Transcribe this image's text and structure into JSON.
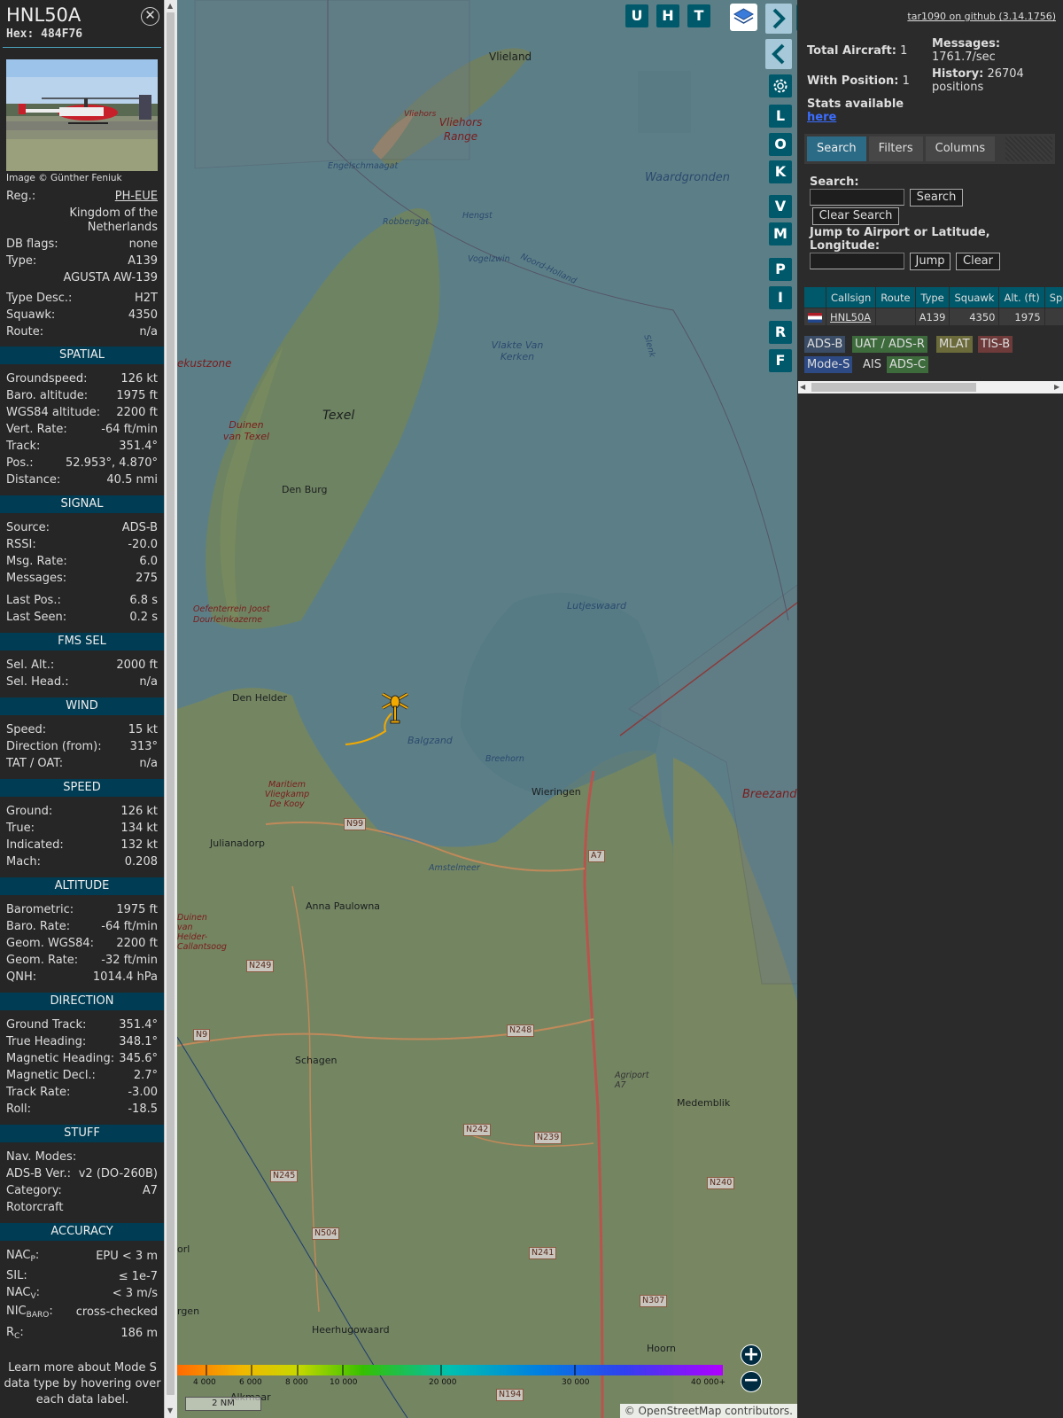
{
  "aircraft": {
    "callsign": "HNL50A",
    "hex_label": "Hex: 484F76",
    "photo_credit": "Image © Günther Feniuk"
  },
  "details": {
    "reg_label": "Reg.:",
    "reg": "PH-EUE",
    "country": "Kingdom of the Netherlands",
    "dbflags_label": "DB flags:",
    "dbflags": "none",
    "type_label": "Type:",
    "type": "A139",
    "type_name": "AGUSTA AW-139",
    "typedesc_label": "Type Desc.:",
    "typedesc": "H2T",
    "squawk_label": "Squawk:",
    "squawk": "4350",
    "route_label": "Route:",
    "route": "n/a"
  },
  "sections": {
    "spatial": {
      "title": "SPATIAL",
      "rows": [
        {
          "label": "Groundspeed:",
          "value": "126 kt"
        },
        {
          "label": "Baro. altitude:",
          "value": "1975 ft"
        },
        {
          "label": "WGS84 altitude:",
          "value": "2200 ft"
        },
        {
          "label": "Vert. Rate:",
          "value": "-64 ft/min"
        },
        {
          "label": "Track:",
          "value": "351.4°"
        },
        {
          "label": "Pos.:",
          "value": "52.953°, 4.870°"
        },
        {
          "label": "Distance:",
          "value": "40.5 nmi"
        }
      ]
    },
    "signal": {
      "title": "SIGNAL",
      "rows": [
        {
          "label": "Source:",
          "value": "ADS-B"
        },
        {
          "label": "RSSI:",
          "value": "-20.0"
        },
        {
          "label": "Msg. Rate:",
          "value": "6.0"
        },
        {
          "label": "Messages:",
          "value": "275"
        },
        {
          "label": "Last Pos.:",
          "value": "6.8 s"
        },
        {
          "label": "Last Seen:",
          "value": "0.2 s"
        }
      ]
    },
    "fms": {
      "title": "FMS SEL",
      "rows": [
        {
          "label": "Sel. Alt.:",
          "value": "2000 ft"
        },
        {
          "label": "Sel. Head.:",
          "value": "n/a"
        }
      ]
    },
    "wind": {
      "title": "WIND",
      "rows": [
        {
          "label": "Speed:",
          "value": "15 kt"
        },
        {
          "label": "Direction (from):",
          "value": "313°"
        },
        {
          "label": "TAT / OAT:",
          "value": "n/a"
        }
      ]
    },
    "speed": {
      "title": "SPEED",
      "rows": [
        {
          "label": "Ground:",
          "value": "126 kt"
        },
        {
          "label": "True:",
          "value": "134 kt"
        },
        {
          "label": "Indicated:",
          "value": "132 kt"
        },
        {
          "label": "Mach:",
          "value": "0.208"
        }
      ]
    },
    "altitude": {
      "title": "ALTITUDE",
      "rows": [
        {
          "label": "Barometric:",
          "value": "1975 ft"
        },
        {
          "label": "Baro. Rate:",
          "value": "-64 ft/min"
        },
        {
          "label": "Geom. WGS84:",
          "value": "2200 ft"
        },
        {
          "label": "Geom. Rate:",
          "value": "-32 ft/min"
        },
        {
          "label": "QNH:",
          "value": "1014.4 hPa"
        }
      ]
    },
    "direction": {
      "title": "DIRECTION",
      "rows": [
        {
          "label": "Ground Track:",
          "value": "351.4°"
        },
        {
          "label": "True Heading:",
          "value": "348.1°"
        },
        {
          "label": "Magnetic Heading:",
          "value": "345.6°"
        },
        {
          "label": "Magnetic Decl.:",
          "value": "2.7°"
        },
        {
          "label": "Track Rate:",
          "value": "-3.00"
        },
        {
          "label": "Roll:",
          "value": "-18.5"
        }
      ]
    },
    "stuff": {
      "title": "STUFF",
      "rows": [
        {
          "label": "Nav. Modes:",
          "value": ""
        },
        {
          "label": "ADS-B Ver.:",
          "value": "v2 (DO-260B)"
        },
        {
          "label": "Category:",
          "value": "A7"
        },
        {
          "label": "Rotorcraft",
          "value": ""
        }
      ]
    },
    "accuracy": {
      "title": "ACCURACY",
      "rows": [
        {
          "label_main": "NAC",
          "label_sub": "P",
          "value": "EPU < 3 m"
        },
        {
          "label_main": "SIL:",
          "label_sub": "",
          "value": "≤ 1e-7"
        },
        {
          "label_main": "NAC",
          "label_sub": "V",
          "value": "< 3 m/s"
        },
        {
          "label_main": "NIC",
          "label_sub": "BARO",
          "value": "cross-checked"
        },
        {
          "label_main": "R",
          "label_sub": "C",
          "value": "186 m"
        }
      ]
    }
  },
  "learn_more": "Learn more about Mode S data type by hovering over each data label.",
  "map": {
    "buttons_top": [
      "U",
      "H",
      "T"
    ],
    "buttons_side": [
      "L",
      "O",
      "K",
      "V",
      "M",
      "P",
      "I",
      "R",
      "F"
    ],
    "places": {
      "vlieland": "Vlieland",
      "vliehors": "Vliehors",
      "vliehors_range": "Vliehors Range",
      "engelschmaagat": "Engelschmaagat",
      "robbengat": "Robbengat",
      "hengst": "Hengst",
      "vogelzwin": "Vogelzwin",
      "noordholland": "Noord-Holland",
      "waardgronden": "Waardgronden",
      "vlakte": "Vlakte Van Kerken",
      "slenk": "Slenk",
      "texel": "Texel",
      "duinen_texel": "Duinen van Texel",
      "kustzone": "ekustzone",
      "den_burg": "Den Burg",
      "oefenterrein": "Oefenterrein Joost Dourleinkazerne",
      "lutjeswaard": "Lutjeswaard",
      "den_helder": "Den Helder",
      "balgzand": "Balgzand",
      "breehorn": "Breehorn",
      "wieringen": "Wieringen",
      "breezand": "Breezand",
      "vliegkamp": "Maritiem Vliegkamp De Kooy",
      "julianadorp": "Julianadorp",
      "amstelmeer": "Amstelmeer",
      "anna_paulowna": "Anna Paulowna",
      "duinen_helder": "Duinen van Helder-Callantsoog",
      "schagen": "Schagen",
      "agriport": "Agriport A7",
      "medemblik": "Medemblik",
      "heerhugowaard": "Heerhugowaard",
      "hoorn": "Hoorn",
      "orl": "orl",
      "rgen": "rgen",
      "alkmaar": "Alkmaar"
    },
    "roads": {
      "n99": "N99",
      "a7": "A7",
      "n249": "N249",
      "n9": "N9",
      "n248": "N248",
      "n242": "N242",
      "n239": "N239",
      "n245": "N245",
      "n240": "N240",
      "n504": "N504",
      "n241": "N241",
      "n307": "N307",
      "n194": "N194"
    },
    "altitude_scale": [
      "4 000",
      "6 000",
      "8 000",
      "10 000",
      "20 000",
      "30 000",
      "40 000+"
    ],
    "distance_scale": "2 NM",
    "attribution_prefix": "© ",
    "attribution_link": "OpenStreetMap",
    "attribution_suffix": " contributors."
  },
  "right_panel": {
    "github_link": "tar1090 on github (3.14.1756)",
    "total_aircraft_label": "Total Aircraft:",
    "total_aircraft": "1",
    "with_position_label": "With Position:",
    "with_position": "1",
    "messages_label": "Messages:",
    "messages": "1761.7/sec",
    "history_label": "History:",
    "history": "26704 positions",
    "stats_label": "Stats available",
    "stats_link": "here",
    "tabs": [
      "Search",
      "Filters",
      "Columns"
    ],
    "search_label": "Search:",
    "search_button": "Search",
    "clear_search_button": "Clear Search",
    "jump_label": "Jump to Airport or Latitude, Longitude:",
    "jump_button": "Jump",
    "clear_button": "Clear",
    "table_headers": [
      "",
      "Callsign",
      "Route",
      "Type",
      "Squawk",
      "Alt. (ft)",
      "Spd."
    ],
    "table_row": {
      "callsign": "HNL50A",
      "route": "",
      "type": "A139",
      "squawk": "4350",
      "alt": "1975",
      "spd": ""
    },
    "source_chips": [
      "ADS-B",
      "UAT / ADS-R",
      "MLAT",
      "TIS-B",
      "Mode-S",
      "AIS",
      "ADS-C"
    ]
  },
  "colors": {
    "accent": "#00596b",
    "section_header": "#003c53",
    "aircraft_icon": "#f2a900",
    "trail": "#f2a900"
  }
}
